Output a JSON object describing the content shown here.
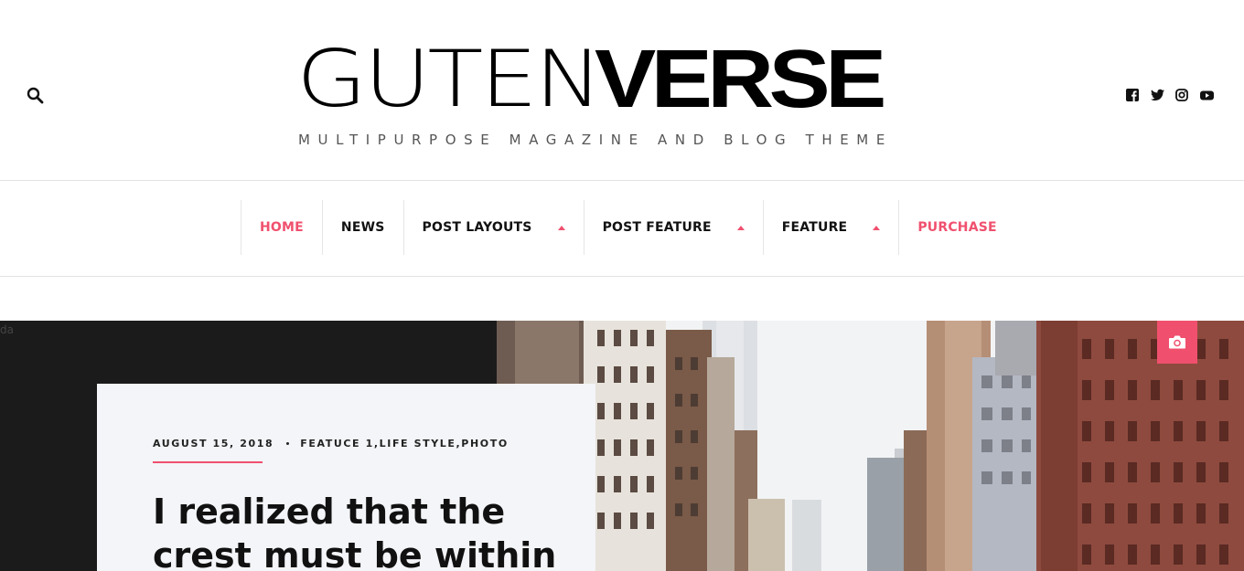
{
  "header": {
    "logo_thin": "GUTEN",
    "logo_bold": "VERSE",
    "tagline": "MULTIPURPOSE MAGAZINE AND BLOG THEME",
    "search_icon": "search-icon",
    "socials": [
      {
        "icon": "facebook-icon"
      },
      {
        "icon": "twitter-icon"
      },
      {
        "icon": "instagram-icon"
      },
      {
        "icon": "youtube-icon"
      }
    ]
  },
  "nav": {
    "items": [
      {
        "label": "HOME",
        "active": true,
        "dropdown": false
      },
      {
        "label": "NEWS",
        "active": false,
        "dropdown": false
      },
      {
        "label": "POST LAYOUTS",
        "active": false,
        "dropdown": true
      },
      {
        "label": "POST FEATURE",
        "active": false,
        "dropdown": true
      },
      {
        "label": "FEATURE",
        "active": false,
        "dropdown": true
      },
      {
        "label": "PURCHASE",
        "active": false,
        "dropdown": false
      }
    ]
  },
  "hero": {
    "stray_text": "da",
    "date": "AUGUST 15, 2018",
    "categories": "FEATUCE 1,LIFE STYLE,PHOTO",
    "title": "I realized that the crest must be within",
    "camera_icon": "camera-icon"
  },
  "colors": {
    "accent": "#f0506e",
    "dark_panel": "#1b1b1b",
    "card_bg": "#f3f5f8"
  }
}
